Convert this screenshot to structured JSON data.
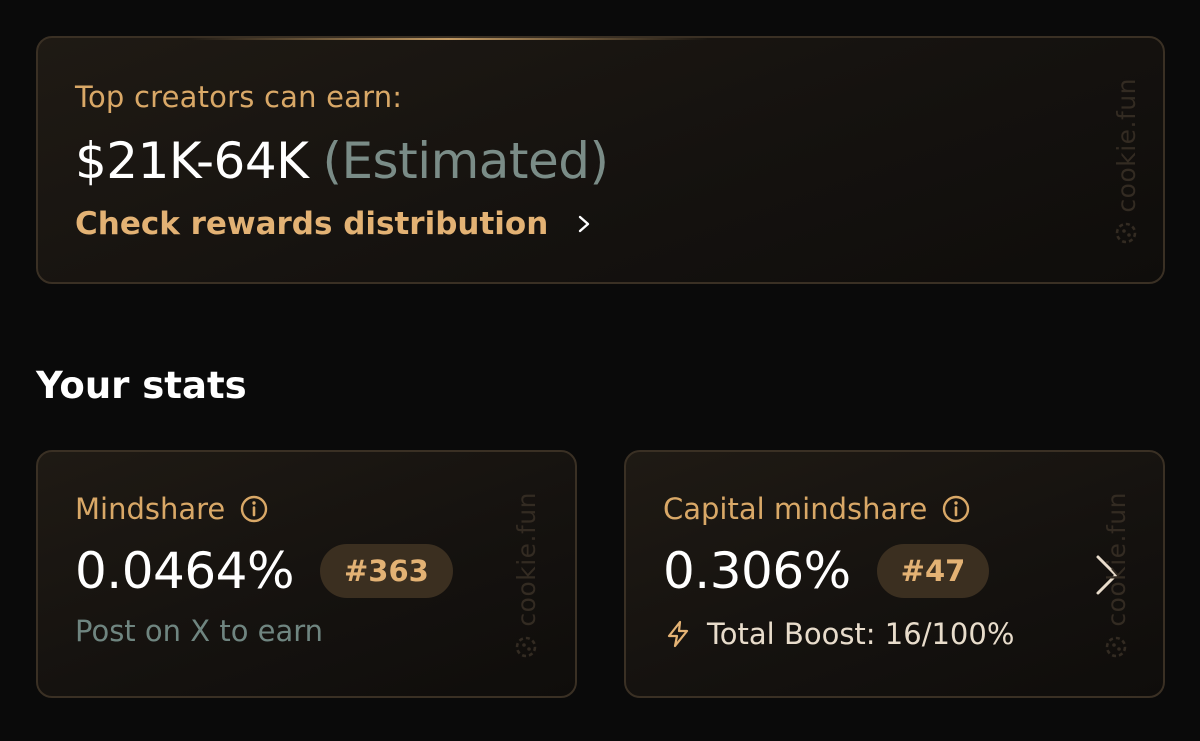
{
  "earn": {
    "label": "Top creators can earn:",
    "amount": "$21K-64K",
    "estimated": "(Estimated)",
    "link_label": "Check rewards distribution"
  },
  "watermark": {
    "text": "cookie.fun",
    "icon": "cookie-logo-icon"
  },
  "stats": {
    "title": "Your stats",
    "mindshare": {
      "label": "Mindshare",
      "value": "0.0464%",
      "rank": "#363",
      "sub": "Post on X to earn"
    },
    "capital": {
      "label": "Capital mindshare",
      "value": "0.306%",
      "rank": "#47",
      "boost": "Total Boost: 16/100%"
    }
  },
  "icons": {
    "info": "info-icon",
    "bolt": "lightning-bolt-icon",
    "chevron": "chevron-right-icon"
  },
  "colors": {
    "background": "#0a0a0a",
    "accent_gold": "#d9a867",
    "link_gold": "#e3b274",
    "muted_teal": "#7a8c87",
    "badge_bg": "#3b2f20",
    "card_border": "#3a3024"
  }
}
